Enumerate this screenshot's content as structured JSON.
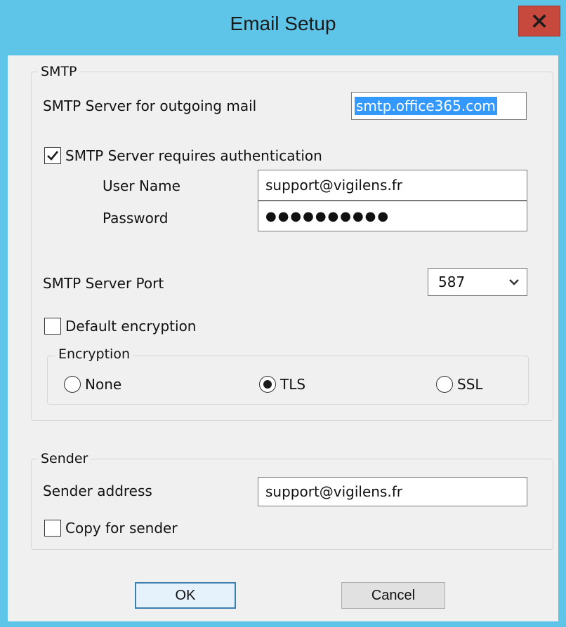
{
  "window": {
    "title": "Email Setup"
  },
  "smtp": {
    "group_label": "SMTP",
    "server_label": "SMTP Server for outgoing mail",
    "server_value": "smtp.office365.com",
    "auth_label": "SMTP Server requires authentication",
    "auth_checked": true,
    "username_label": "User Name",
    "username_value": "support@vigilens.fr",
    "password_label": "Password",
    "password_value": "●●●●●●●●●●",
    "port_label": "SMTP Server Port",
    "port_value": "587",
    "default_encryption_label": "Default encryption",
    "default_encryption_checked": false,
    "encryption": {
      "group_label": "Encryption",
      "options": [
        "None",
        "TLS",
        "SSL"
      ],
      "selected": "TLS"
    }
  },
  "sender": {
    "group_label": "Sender",
    "address_label": "Sender address",
    "address_value": "support@vigilens.fr",
    "copy_label": "Copy for sender",
    "copy_checked": false
  },
  "buttons": {
    "ok_label": "OK",
    "cancel_label": "Cancel"
  },
  "icons": {
    "close": "close-icon",
    "check": "checkmark-icon",
    "dropdown": "chevron-down-icon"
  },
  "colors": {
    "titlebar": "#5ec4e8",
    "close_button": "#c7483c",
    "selection": "#3399ff",
    "dialog_bg": "#f0f0f0"
  }
}
